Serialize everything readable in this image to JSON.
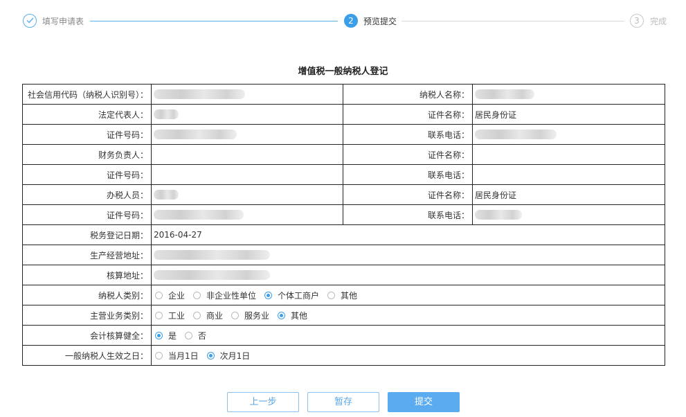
{
  "steps": [
    {
      "label": "填写申请表",
      "state": "done"
    },
    {
      "label": "预览提交",
      "number": "2",
      "state": "active"
    },
    {
      "label": "完成",
      "number": "3",
      "state": "todo"
    }
  ],
  "form": {
    "title": "增值税一般纳税人登记",
    "labels": {
      "credit_code": "社会信用代码（纳税人识别号）：",
      "taxpayer_name": "纳税人名称：",
      "legal_rep": "法定代表人：",
      "cert_name": "证件名称：",
      "cert_no": "证件号码：",
      "phone": "联系电话：",
      "finance_head": "财务负责人：",
      "tax_agent": "办税人员：",
      "reg_date": "税务登记日期：",
      "biz_address": "生产经营地址：",
      "acct_address": "核算地址：",
      "taxpayer_type": "纳税人类别：",
      "main_biz_type": "主营业务类别：",
      "accounting_sound": "会计核算健全：",
      "effective_date": "一般纳税人生效之日："
    },
    "values": {
      "legal_rep_cert_name": "居民身份证",
      "tax_agent_cert_name": "居民身份证",
      "reg_date": "2016-04-27"
    },
    "taxpayer_type_options": [
      "企业",
      "非企业性单位",
      "个体工商户",
      "其他"
    ],
    "taxpayer_type_selected": 2,
    "main_biz_options": [
      "工业",
      "商业",
      "服务业",
      "其他"
    ],
    "main_biz_selected": 3,
    "accounting_options": [
      "是",
      "否"
    ],
    "accounting_selected": 0,
    "effective_options": [
      "当月1日",
      "次月1日"
    ],
    "effective_selected": 1
  },
  "buttons": {
    "prev": "上一步",
    "save": "暂存",
    "submit": "提交"
  },
  "colors": {
    "accent": "#3a9fe8",
    "primary_button": "#5aabf0"
  }
}
